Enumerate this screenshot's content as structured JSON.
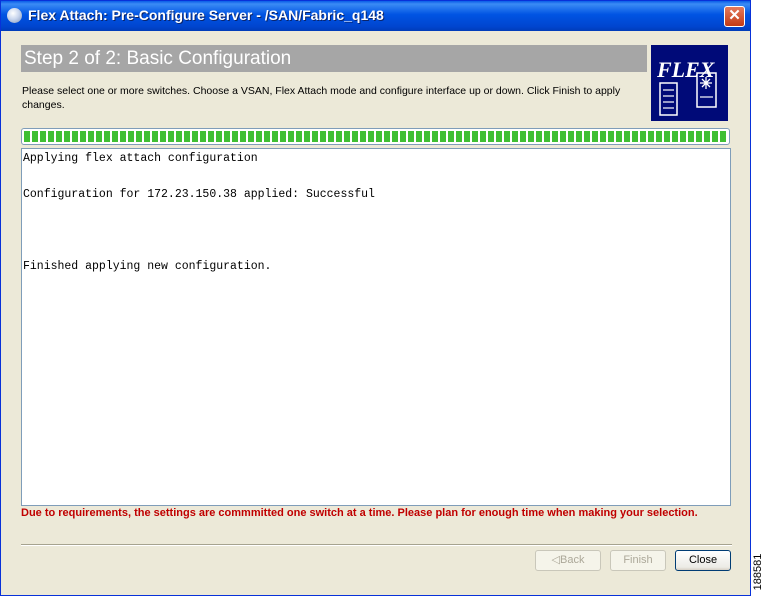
{
  "window": {
    "title": "Flex Attach: Pre-Configure Server - /SAN/Fabric_q148",
    "close_glyph": "✕"
  },
  "banner": {
    "step_title": "Step 2 of 2:  Basic Configuration"
  },
  "instructions": "Please select one or more switches.  Choose a VSAN, Flex Attach mode and configure interface up or down.  Click Finish to apply changes.",
  "logo": {
    "text": "FLEX",
    "icon": "flex-attach-logo-icon"
  },
  "progress": {
    "fraction": 1.0,
    "color": "#3fbf33"
  },
  "log": {
    "lines": [
      "Applying flex attach configuration",
      "Configuration for 172.23.150.38 applied: Successful",
      "Finished applying new configuration."
    ]
  },
  "warning": "Due to requirements, the settings are commmitted one switch at a time. Please plan for enough time when making your selection.",
  "buttons": {
    "back": "◁Back",
    "finish": "Finish",
    "close": "Close"
  },
  "figure_id": "188581",
  "colors": {
    "title_bar": "#0054e3",
    "warning": "#c00000",
    "banner": "#a6a6a6",
    "logo_bg": "#000a78"
  }
}
